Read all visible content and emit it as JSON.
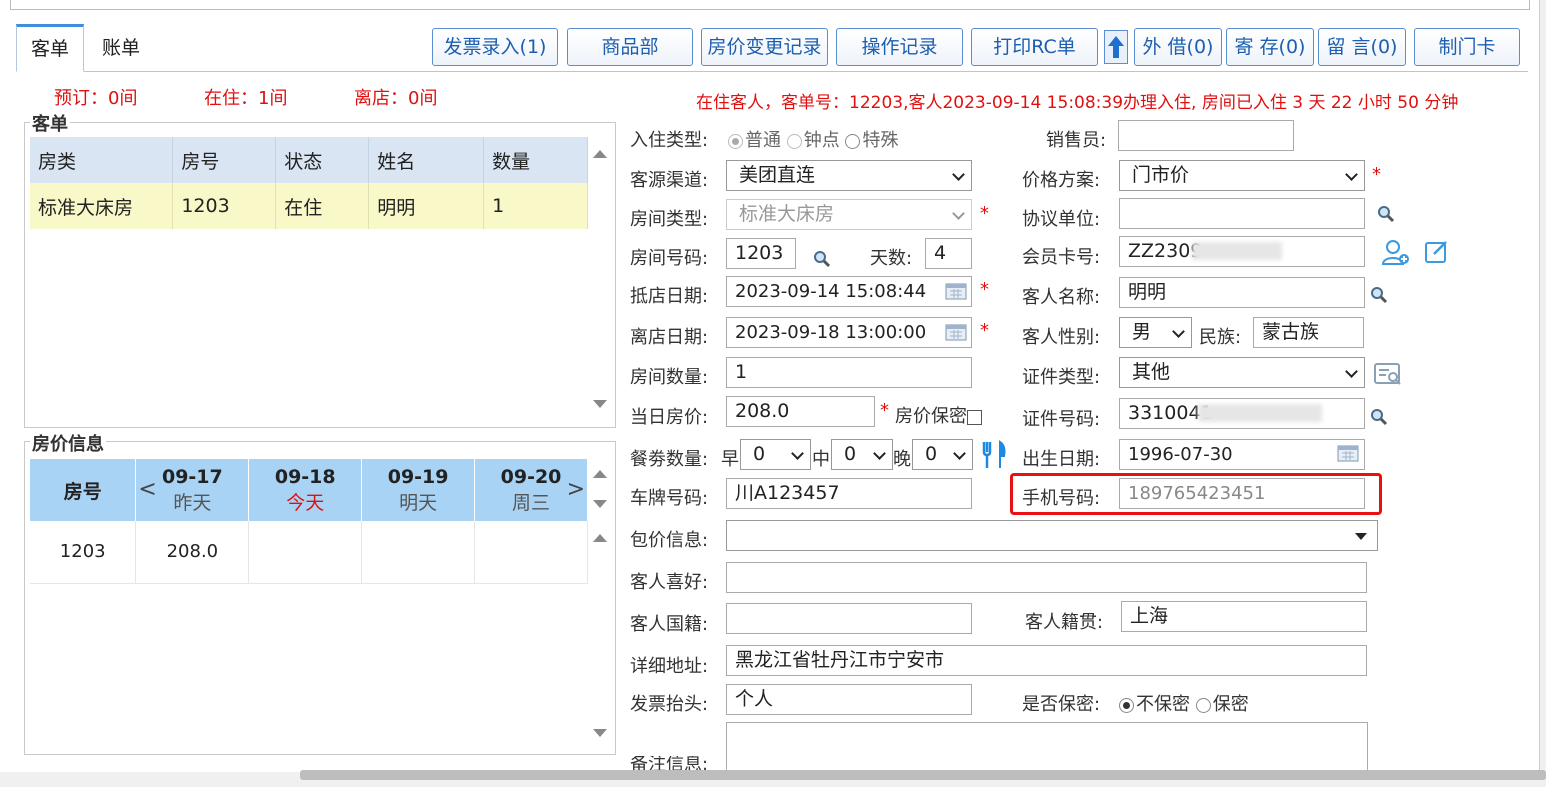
{
  "tabs": [
    {
      "label": "客单"
    },
    {
      "label": "账单"
    }
  ],
  "toolbar": {
    "invoice": "发票录入(1)",
    "goods": "商品部",
    "price_history": "房价变更记录",
    "op_log": "操作记录",
    "print_rc": "打印RC单",
    "borrow": "外 借(0)",
    "deposit": "寄 存(0)",
    "message": "留 言(0)",
    "make_card": "制门卡"
  },
  "counts": {
    "reserved": "预订：0间",
    "in_house": "在住：1间",
    "departed": "离店：0间"
  },
  "notice": "在住客人，客单号：12203,客人2023-09-14 15:08:39办理入住, 房间已入住 3 天 22 小时 50 分钟",
  "order_panel": {
    "title": "客单",
    "columns": [
      "房类",
      "房号",
      "状态",
      "姓名",
      "数量"
    ],
    "rows": [
      [
        "标准大床房",
        "1203",
        "在住",
        "明明",
        "1"
      ]
    ]
  },
  "price_panel": {
    "title": "房价信息",
    "room_col": "房号",
    "days": [
      {
        "date": "09-17",
        "label": "昨天"
      },
      {
        "date": "09-18",
        "label": "今天"
      },
      {
        "date": "09-19",
        "label": "明天"
      },
      {
        "date": "09-20",
        "label": "周三"
      }
    ],
    "rows": [
      {
        "room": "1203",
        "prices": [
          "208.0",
          "",
          "",
          ""
        ]
      }
    ]
  },
  "form": {
    "checkin_type": {
      "label": "入住类型:",
      "options": [
        "普通",
        "钟点",
        "特殊"
      ],
      "selected": "普通"
    },
    "salesperson": {
      "label": "销售员:",
      "value": ""
    },
    "source": {
      "label": "客源渠道:",
      "value": "美团直连"
    },
    "price_plan": {
      "label": "价格方案:",
      "value": "门市价"
    },
    "room_type": {
      "label": "房间类型:",
      "value": "标准大床房"
    },
    "agreement": {
      "label": "协议单位:",
      "value": ""
    },
    "room_no": {
      "label": "房间号码:",
      "value": "1203"
    },
    "days": {
      "label": "天数:",
      "value": "4"
    },
    "member_card": {
      "label": "会员卡号:",
      "value": "ZZ2309"
    },
    "arrival": {
      "label": "抵店日期:",
      "value": "2023-09-14 15:08:44"
    },
    "guest_name": {
      "label": "客人名称:",
      "value": "明明"
    },
    "departure": {
      "label": "离店日期:",
      "value": "2023-09-18 13:00:00"
    },
    "gender": {
      "label": "客人性别:",
      "value": "男"
    },
    "ethnicity": {
      "label": "民族:",
      "value": "蒙古族"
    },
    "room_count": {
      "label": "房间数量:",
      "value": "1"
    },
    "id_type": {
      "label": "证件类型:",
      "value": "其他"
    },
    "daily_rate": {
      "label": "当日房价:",
      "value": "208.0"
    },
    "rate_secret": {
      "label": "房价保密",
      "checked": false
    },
    "id_no": {
      "label": "证件号码:",
      "value": "3310041"
    },
    "meal": {
      "label": "餐劵数量:",
      "breakfast_label": "早",
      "breakfast": "0",
      "lunch_label": "中",
      "lunch": "0",
      "dinner_label": "晚",
      "dinner": "0"
    },
    "birthday": {
      "label": "出生日期:",
      "value": "1996-07-30"
    },
    "plate": {
      "label": "车牌号码:",
      "value": "川A123457"
    },
    "phone": {
      "label": "手机号码:",
      "value": "189765423451"
    },
    "package": {
      "label": "包价信息:",
      "value": ""
    },
    "preference": {
      "label": "客人喜好:",
      "value": ""
    },
    "nationality": {
      "label": "客人国籍:",
      "value": ""
    },
    "native_place": {
      "label": "客人籍贯:",
      "value": "上海"
    },
    "address": {
      "label": "详细地址:",
      "value": "黑龙江省牡丹江市宁安市"
    },
    "invoice_title": {
      "label": "发票抬头:",
      "value": "个人"
    },
    "confidential": {
      "label": "是否保密:",
      "options": [
        "不保密",
        "保密"
      ],
      "selected": "不保密"
    },
    "remarks": {
      "label": "备注信息:",
      "value": ""
    }
  },
  "colors": {
    "accent_blue": "#1c5fb0",
    "alert_red": "#e01010",
    "header_blue": "#a9d3f5",
    "selected_row": "#f8f8c8",
    "highlight_box": "#e81010"
  }
}
